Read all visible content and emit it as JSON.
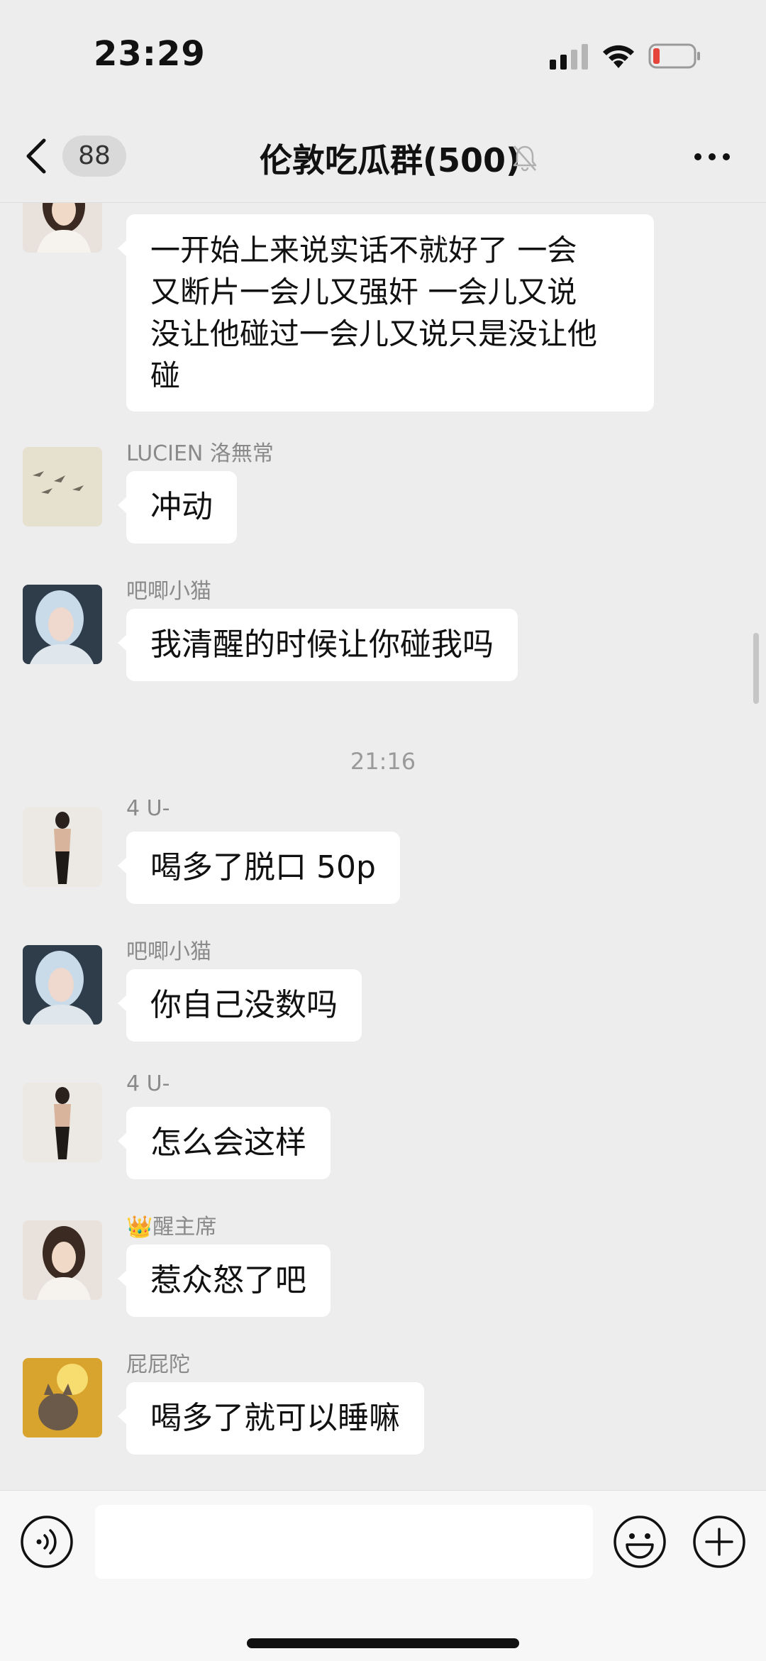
{
  "status_bar": {
    "time": "23:29"
  },
  "nav": {
    "unread_count": "88",
    "title": "伦敦吃瓜群(500)",
    "icons": [
      "chevron-left-icon",
      "bell-muted-icon",
      "more-dots-icon"
    ]
  },
  "messages": [
    {
      "sender": "",
      "text_lines": [
        "一开始上来说实话不就好了 一会",
        "又断片一会儿又强奸 一会儿又说",
        "没让他碰过一会儿又说只是没让他",
        "碰"
      ]
    },
    {
      "sender": "LUCIEN 洛無常",
      "text": "冲动"
    },
    {
      "sender": "吧唧小猫",
      "text": "我清醒的时候让你碰我吗"
    },
    {
      "sender": "4 U-",
      "text": "喝多了脱口 50p"
    },
    {
      "sender": "吧唧小猫",
      "text": "你自己没数吗"
    },
    {
      "sender": "4 U-",
      "text": "怎么会这样"
    },
    {
      "sender": "醒主席",
      "sender_badge": "👑",
      "text": "惹众怒了吧"
    },
    {
      "sender": "屁屁陀",
      "text": "喝多了就可以睡嘛"
    }
  ],
  "time_divider": "21:16",
  "input_bar": {
    "placeholder": "",
    "icons": [
      "voice-icon",
      "emoji-icon",
      "plus-icon"
    ]
  },
  "colors": {
    "background": "#ededed",
    "bubble": "#ffffff",
    "sender_name": "#8a8a8a",
    "battery_low": "#e5453b"
  }
}
